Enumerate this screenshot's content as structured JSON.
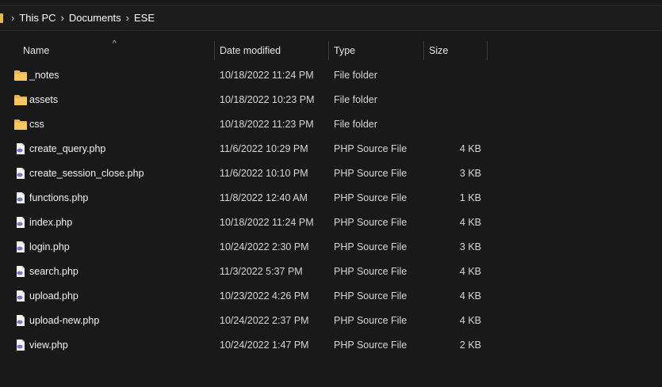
{
  "breadcrumb": {
    "items": [
      "This PC",
      "Documents",
      "ESE"
    ]
  },
  "columns": {
    "name": "Name",
    "date": "Date modified",
    "type": "Type",
    "size": "Size"
  },
  "files": [
    {
      "name": "_notes",
      "date": "10/18/2022 11:24 PM",
      "type": "File folder",
      "size": "",
      "icon": "folder-icon"
    },
    {
      "name": "assets",
      "date": "10/18/2022 10:23 PM",
      "type": "File folder",
      "size": "",
      "icon": "folder-icon"
    },
    {
      "name": "css",
      "date": "10/18/2022 11:23 PM",
      "type": "File folder",
      "size": "",
      "icon": "folder-icon"
    },
    {
      "name": "create_query.php",
      "date": "11/6/2022 10:29 PM",
      "type": "PHP Source File",
      "size": "4 KB",
      "icon": "php-file-icon"
    },
    {
      "name": "create_session_close.php",
      "date": "11/6/2022 10:10 PM",
      "type": "PHP Source File",
      "size": "3 KB",
      "icon": "php-file-icon"
    },
    {
      "name": "functions.php",
      "date": "11/8/2022 12:40 AM",
      "type": "PHP Source File",
      "size": "1 KB",
      "icon": "php-file-icon"
    },
    {
      "name": "index.php",
      "date": "10/18/2022 11:24 PM",
      "type": "PHP Source File",
      "size": "4 KB",
      "icon": "php-file-icon"
    },
    {
      "name": "login.php",
      "date": "10/24/2022 2:30 PM",
      "type": "PHP Source File",
      "size": "3 KB",
      "icon": "php-file-icon"
    },
    {
      "name": "search.php",
      "date": "11/3/2022 5:37 PM",
      "type": "PHP Source File",
      "size": "4 KB",
      "icon": "php-file-icon"
    },
    {
      "name": "upload.php",
      "date": "10/23/2022 4:26 PM",
      "type": "PHP Source File",
      "size": "4 KB",
      "icon": "php-file-icon"
    },
    {
      "name": "upload-new.php",
      "date": "10/24/2022 2:37 PM",
      "type": "PHP Source File",
      "size": "4 KB",
      "icon": "php-file-icon"
    },
    {
      "name": "view.php",
      "date": "10/24/2022 1:47 PM",
      "type": "PHP Source File",
      "size": "2 KB",
      "icon": "php-file-icon"
    }
  ],
  "colors": {
    "background": "#191919",
    "folder": "#e8b84a",
    "php_badge": "#7a78c6"
  }
}
